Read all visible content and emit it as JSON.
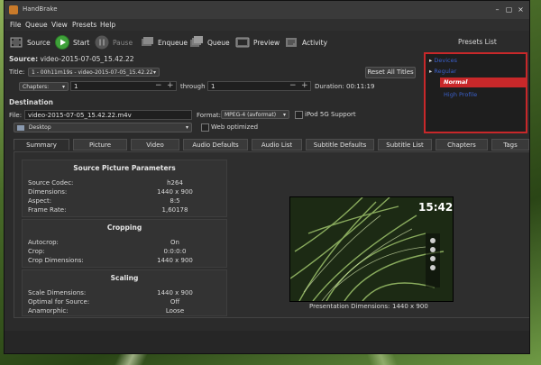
{
  "window": {
    "title": "HandBrake"
  },
  "menu": [
    "File",
    "Queue",
    "View",
    "Presets",
    "Help"
  ],
  "toolbar": {
    "source": "Source",
    "start": "Start",
    "pause": "Pause",
    "enqueue": "Enqueue",
    "queue": "Queue",
    "preview": "Preview",
    "activity": "Activity"
  },
  "source": {
    "label": "Source:",
    "value": "video-2015-07-05_15.42.22"
  },
  "title_row": {
    "label": "Title:",
    "value": "1 - 00h11m19s - video-2015-07-05_15.42.22",
    "reset": "Reset All Titles"
  },
  "range": {
    "mode": "Chapters:",
    "from": "1",
    "through_label": "through",
    "to": "1",
    "duration_label": "Duration:",
    "duration": "00:11:19"
  },
  "destination": {
    "heading": "Destination",
    "file_label": "File:",
    "file": "video-2015-07-05_15.42.22.m4v",
    "format_label": "Format:",
    "format": "MPEG-4 (avformat)",
    "ipod": "iPod 5G Support",
    "web": "Web optimized",
    "folder": "Desktop"
  },
  "presets": {
    "title": "Presets List",
    "items": [
      {
        "label": "Devices",
        "indent": 0,
        "selected": false,
        "expander": true
      },
      {
        "label": "Regular",
        "indent": 0,
        "selected": false,
        "expander": true
      },
      {
        "label": "Normal",
        "indent": 1,
        "selected": true,
        "expander": false
      },
      {
        "label": "High Profile",
        "indent": 1,
        "selected": false,
        "expander": false
      }
    ]
  },
  "tabs": [
    "Summary",
    "Picture",
    "Video",
    "Audio Defaults",
    "Audio List",
    "Subtitle Defaults",
    "Subtitle List",
    "Chapters",
    "Tags"
  ],
  "summary": {
    "source_params": {
      "title": "Source Picture Parameters",
      "rows": [
        {
          "k": "Source Codec:",
          "v": "h264"
        },
        {
          "k": "Dimensions:",
          "v": "1440 x 900"
        },
        {
          "k": "Aspect:",
          "v": "8:5"
        },
        {
          "k": "Frame Rate:",
          "v": "1,60178"
        }
      ]
    },
    "cropping": {
      "title": "Cropping",
      "rows": [
        {
          "k": "Autocrop:",
          "v": "On"
        },
        {
          "k": "Crop:",
          "v": "0:0:0:0"
        },
        {
          "k": "Crop Dimensions:",
          "v": "1440 x 900"
        }
      ]
    },
    "scaling": {
      "title": "Scaling",
      "rows": [
        {
          "k": "Scale Dimensions:",
          "v": "1440 x 900"
        },
        {
          "k": "Optimal for Source:",
          "v": "Off"
        },
        {
          "k": "Anamorphic:",
          "v": "Loose"
        }
      ]
    },
    "presentation": {
      "label": "Presentation Dimensions:",
      "value": "1440 x 900"
    },
    "preview_clock": "15:42"
  },
  "colors": {
    "accent": "#c8282a",
    "window_bg": "#2b2b2b",
    "start_green": "#3fa13a"
  }
}
